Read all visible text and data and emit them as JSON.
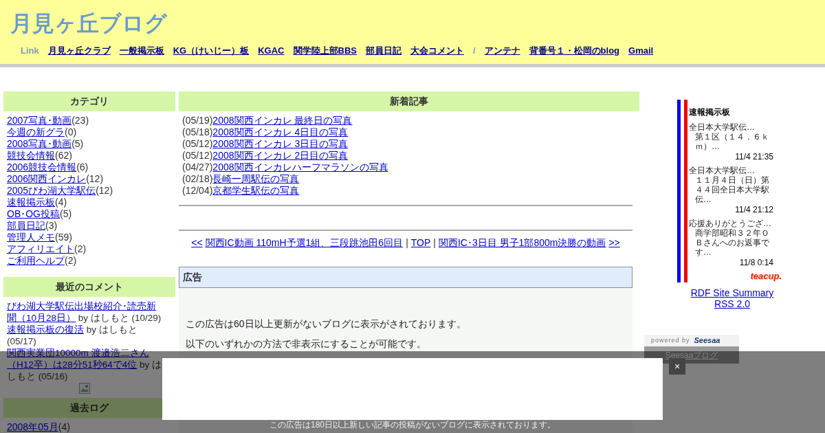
{
  "header": {
    "title": "月見ヶ丘ブログ",
    "link_label": "Link",
    "links": [
      {
        "kind": "link",
        "text": "月見ヶ丘クラブ"
      },
      {
        "kind": "link",
        "text": "一般掲示板"
      },
      {
        "kind": "link",
        "text": "KG（けいじー）板"
      },
      {
        "kind": "link",
        "text": "KGAC"
      },
      {
        "kind": "link",
        "text": "関学陸上部BBS"
      },
      {
        "kind": "link",
        "text": "部員日記"
      },
      {
        "kind": "link",
        "text": "大会コメント"
      },
      {
        "kind": "separator",
        "text": "/"
      },
      {
        "kind": "link",
        "text": "アンテナ"
      },
      {
        "kind": "link",
        "text": "背番号１・松岡のblog"
      },
      {
        "kind": "link",
        "text": "Gmail"
      }
    ]
  },
  "sidebar": {
    "categories": {
      "title": "カテゴリ",
      "items": [
        {
          "name": "2007写真･動画",
          "count": "(23)"
        },
        {
          "name": "今週の新グラ",
          "count": "(0)"
        },
        {
          "name": "2008写真･動画",
          "count": "(5)"
        },
        {
          "name": "競技会情報",
          "count": "(62)"
        },
        {
          "name": "2006競技会情報",
          "count": "(6)"
        },
        {
          "name": "2006関西インカレ",
          "count": "(12)"
        },
        {
          "name": "2005びわ湖大学駅伝",
          "count": "(12)"
        },
        {
          "name": "速報掲示板",
          "count": "(4)"
        },
        {
          "name": "OB･OG投稿",
          "count": "(5)"
        },
        {
          "name": "部員日記",
          "count": "(3)"
        },
        {
          "name": "管理人メモ",
          "count": "(59)"
        },
        {
          "name": "アフィリエイト",
          "count": "(2)"
        },
        {
          "name": "ご利用ヘルプ",
          "count": "(2)"
        }
      ]
    },
    "recent_comments": {
      "title": "最近のコメント",
      "items": [
        {
          "title": "びわ湖大学駅伝出場校紹介･読売新聞（10月28日）",
          "by": "by はしもと (10/29)"
        },
        {
          "title": "速報掲示板の復活",
          "by": "by はしもと (05/17)"
        },
        {
          "title": "関西実業団10000m 渡邉浩二さん（H12卒）は28分51秒64で4位",
          "by": "by はしもと (05/16)"
        }
      ]
    },
    "archive": {
      "title": "過去ログ",
      "items": [
        {
          "name": "2008年05月",
          "count": "(4)"
        }
      ]
    }
  },
  "main": {
    "recent": {
      "title": "新着記事",
      "items": [
        {
          "date": "(05/19)",
          "title": "2008関西インカレ 最終日の写真"
        },
        {
          "date": "(05/18)",
          "title": "2008関西インカレ 4日目の写真"
        },
        {
          "date": "(05/12)",
          "title": "2008関西インカレ 3日目の写真"
        },
        {
          "date": "(05/12)",
          "title": "2008関西インカレ 2日目の写真"
        },
        {
          "date": "(04/27)",
          "title": "2008関西インカレハーフマラソンの写真"
        },
        {
          "date": "(02/18)",
          "title": "長崎一周駅伝の写真"
        },
        {
          "date": "(12/04)",
          "title": "京都学生駅伝の写真"
        }
      ]
    },
    "pager": [
      {
        "kind": "link",
        "text": "<<"
      },
      {
        "kind": "link",
        "text": "関西IC動画 110mH予選1組、三段跳池田6回目"
      },
      {
        "kind": "text",
        "text": "|"
      },
      {
        "kind": "link",
        "text": "TOP"
      },
      {
        "kind": "text",
        "text": "|"
      },
      {
        "kind": "link",
        "text": "関西IC･3日目 男子1部800m決勝の動画"
      },
      {
        "kind": "link",
        "text": ">>"
      }
    ],
    "ad": {
      "title": "広告",
      "paragraphs": [
        "この広告は60日以上更新がないブログに表示がされております。",
        "以下のいずれかの方法で非表示にすることが可能です。"
      ]
    }
  },
  "bbs_widget": {
    "title": "速報掲示板",
    "posts": [
      {
        "title": "全日本大学駅伝…",
        "excerpt": "第１区（１４．６ｋｍ）…",
        "time": "11/4 21:35"
      },
      {
        "title": "全日本大学駅伝…",
        "excerpt": "１１月４日（日）第４４回全日本大学駅伝…",
        "time": "11/4 21:12"
      },
      {
        "title": "応援ありがとうござ…",
        "excerpt": "商学部昭和３２年ＯＢさんへのお返事です…",
        "time": "11/8 0:14"
      }
    ],
    "logo": "teacup."
  },
  "feeds": [
    "RDF Site Summary",
    "RSS 2.0"
  ],
  "seesaa": {
    "powered_by": "powered by",
    "logo": "Seesaa",
    "link": "Seesaaブログ"
  },
  "overlay": {
    "close": "×",
    "notice": "この広告は180日以上新しい記事の投稿がないブログに表示されております。"
  }
}
